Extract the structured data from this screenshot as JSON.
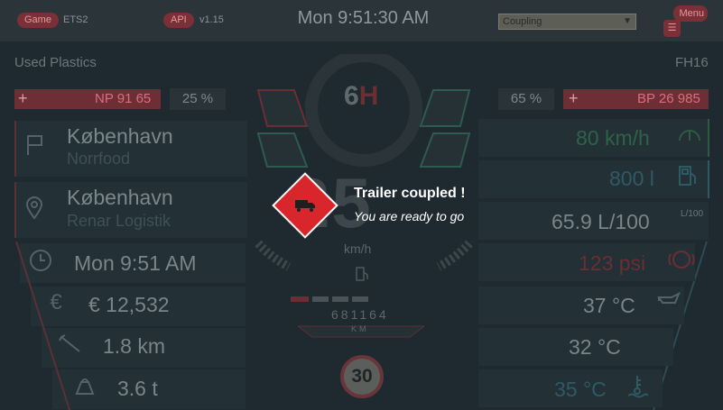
{
  "topbar": {
    "game_tag": "Game",
    "game_value": "ETS2",
    "api_tag": "API",
    "api_value": "v1.15",
    "clock": "Mon 9:51:30 AM",
    "skin_select": "Coupling",
    "menu_label": "Menu"
  },
  "job": {
    "cargo": "Used Plastics",
    "truck_model": "FH16",
    "left_plate": "NP 91 65",
    "left_damage": "25 %",
    "right_damage": "65 %",
    "right_plate": "BP 26 985"
  },
  "destination": {
    "source_city": "København",
    "source_company": "Norrfood",
    "dest_city": "København",
    "dest_company": "Renar Logistik"
  },
  "stats_left": {
    "time": "Mon 9:51 AM",
    "income": "€ 12,532",
    "distance": "1.8 km",
    "weight": "3.6 t"
  },
  "stats_right": {
    "speed_limit_value": "80 km/h",
    "fuel": "800 l",
    "consumption": "65.9 L/100",
    "air_pressure": "123 psi",
    "oil_temp": "37 °C",
    "water_temp_a": "32 °C",
    "water_temp_b": "35 °C",
    "consumption_icon_label": "L/100"
  },
  "dash": {
    "gear": "6",
    "gear_suffix": "H",
    "speed": "25",
    "speed_unit": "km/h",
    "odometer": "681164",
    "odometer_unit": "KM",
    "speed_limit_sign": "30"
  },
  "toast": {
    "title": "Trailer coupled !",
    "subtitle": "You are ready to go"
  },
  "colors": {
    "accent_red": "#d8262c",
    "background": "#1f2a30"
  }
}
